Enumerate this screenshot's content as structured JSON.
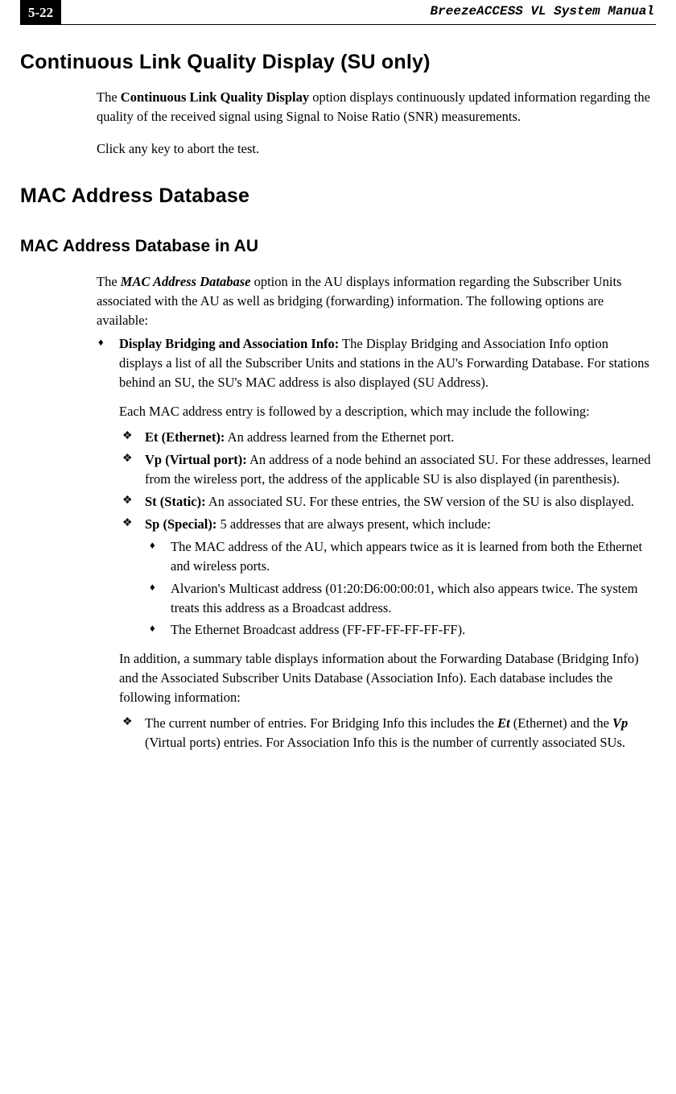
{
  "header": {
    "page_number": "5-22",
    "doc_title": "BreezeACCESS VL System Manual"
  },
  "h1a": "Continuous Link Quality Display (SU only)",
  "p1a": "The ",
  "p1b": "Continuous Link Quality Display",
  "p1c": " option displays continuously updated information regarding the quality of the received signal using Signal to Noise Ratio (SNR) measurements.",
  "p2": "Click any key to abort the test.",
  "h1b": "MAC Address Database",
  "h2a": "MAC Address Database in AU",
  "p3a": "The ",
  "p3b": "MAC Address Database",
  "p3c": " option in the AU displays information regarding the Subscriber Units associated with the AU as well as bridging (forwarding) information. The following options are available:",
  "d1": {
    "label": "Display Bridging and Association Info:",
    "text": " The Display Bridging and Association Info option displays a list of all the Subscriber Units and stations in the AU's Forwarding Database. For stations behind an SU, the SU's MAC address is also displayed (SU Address).",
    "p2": "Each MAC address entry is followed by a description, which may include the following:",
    "f1": {
      "label": "Et (Ethernet):",
      "text": " An address learned from the Ethernet port."
    },
    "f2": {
      "label": "Vp (Virtual port):",
      "text": " An address of a node behind an associated SU. For these addresses, learned from the wireless port, the address of the applicable SU is also displayed (in parenthesis)."
    },
    "f3": {
      "label": "St (Static):",
      "text": " An associated SU. For these entries, the SW version of the SU is also displayed."
    },
    "f4": {
      "label": "Sp (Special):",
      "text": " 5 addresses that are always present, which include:",
      "s1": "The MAC address of the AU, which appears twice as it is learned from both the Ethernet and wireless ports.",
      "s2": "Alvarion's Multicast address (01:20:D6:00:00:01, which also appears twice. The system treats this address as a Broadcast address.",
      "s3": "The Ethernet Broadcast address (FF-FF-FF-FF-FF-FF)."
    },
    "p3": "In addition, a summary table displays information about the Forwarding Database (Bridging Info) and the Associated Subscriber Units Database (Association Info). Each database includes the following information:",
    "f5a": "The current number of entries. For Bridging Info this includes the ",
    "f5b": "Et",
    "f5c": " (Ethernet) and the ",
    "f5d": "Vp",
    "f5e": " (Virtual ports) entries. For Association Info this is the number of currently associated SUs."
  }
}
